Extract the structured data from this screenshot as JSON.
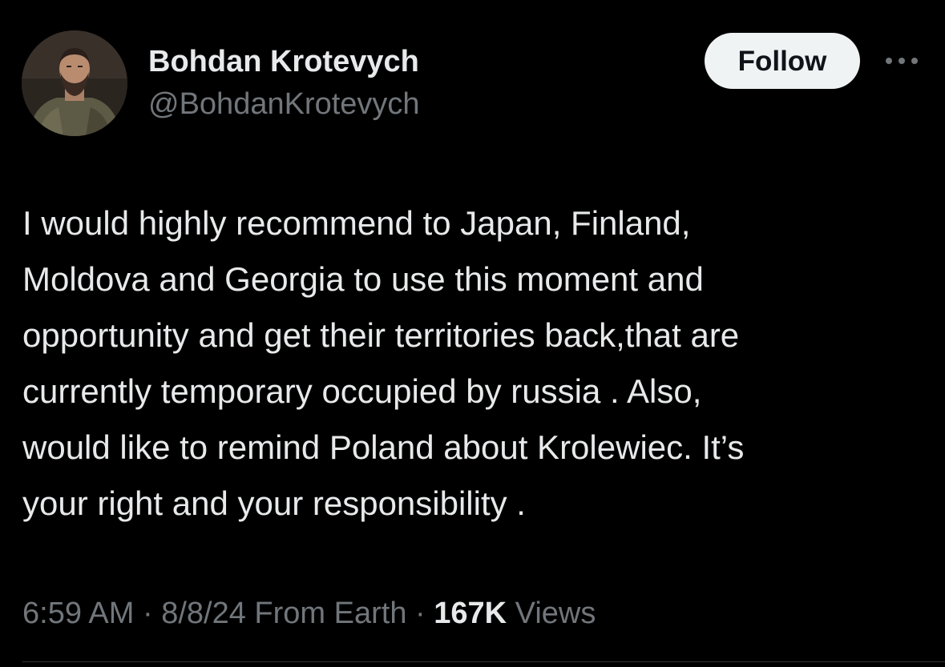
{
  "author": {
    "display_name": "Bohdan Krotevych",
    "handle": "@BohdanKrotevych",
    "avatar_icon": "user-avatar-photo"
  },
  "actions": {
    "follow_label": "Follow",
    "more_icon": "more-horizontal-icon"
  },
  "tweet": {
    "lines": [
      "I would highly recommend to Japan, Finland,",
      "Moldova and Georgia to use this moment and",
      "opportunity and get their territories back,that are",
      "currently temporary occupied by russia . Also,",
      "would like to remind Poland about Krolewiec. It’s",
      "your right and your responsibility ."
    ]
  },
  "meta": {
    "time": "6:59 AM",
    "sep1": "·",
    "date": "8/8/24",
    "source": "From Earth",
    "sep2": "·",
    "views_count": "167K",
    "views_label": "Views"
  },
  "colors": {
    "background": "#000000",
    "primary_text": "#e7e9ea",
    "secondary_text": "#71767b",
    "follow_button_bg": "#eff3f4"
  }
}
